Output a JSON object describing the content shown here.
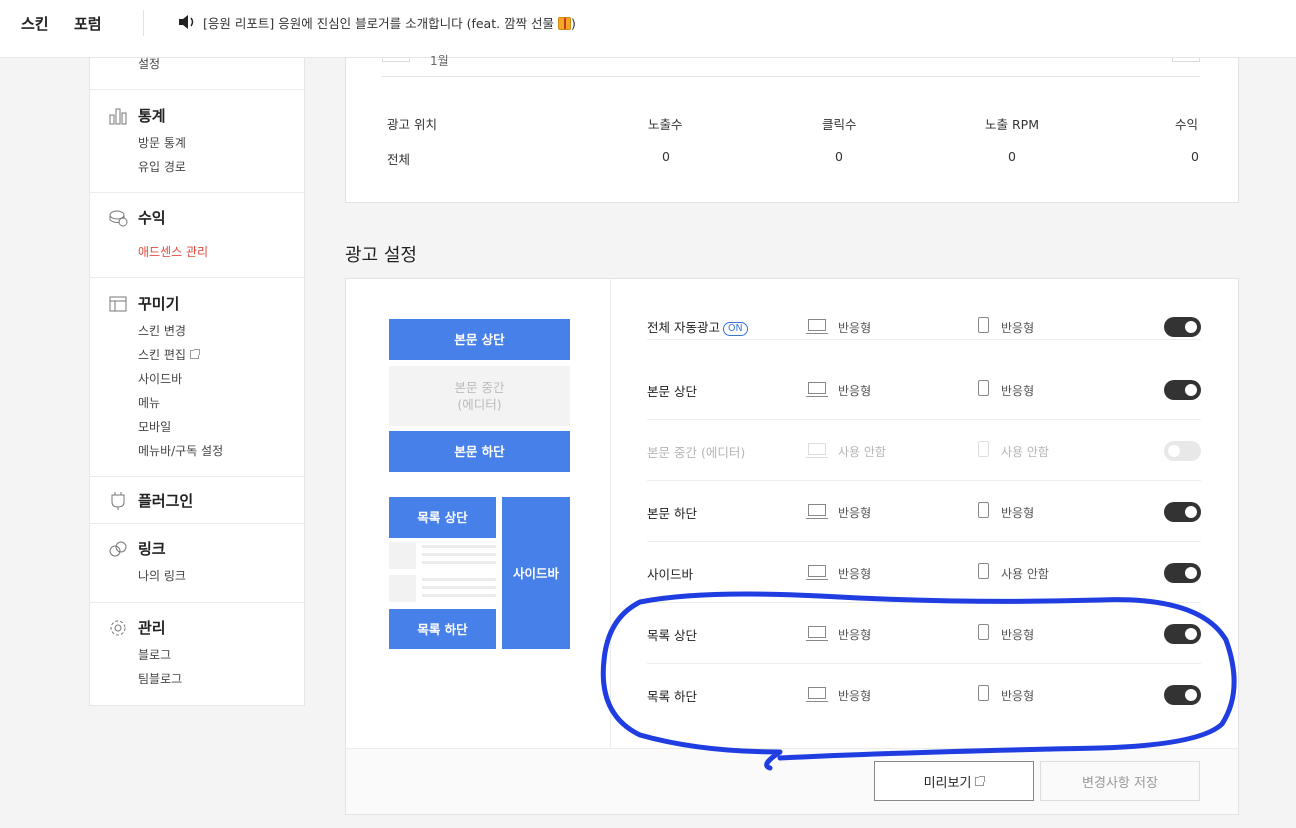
{
  "topbar": {
    "nav": [
      "스킨",
      "포럼"
    ],
    "notice": "[응원 리포트] 응원에 진심인 블로거를 소개합니다 (feat. 깜짝 선물",
    "notice_end": ")"
  },
  "sidebar": {
    "cut_link": "설정",
    "sections": [
      {
        "title": "통계",
        "icon": "bar-chart-icon",
        "links": [
          "방문 통계",
          "유입 경로"
        ]
      },
      {
        "title": "수익",
        "icon": "coins-icon",
        "links": [
          "애드센스 관리"
        ],
        "active": "애드센스 관리"
      },
      {
        "title": "꾸미기",
        "icon": "layout-icon",
        "links": [
          "스킨 변경",
          "스킨 편집",
          "사이드바",
          "메뉴",
          "모바일",
          "메뉴바/구독 설정"
        ]
      },
      {
        "title": "플러그인",
        "icon": "plug-icon",
        "links": []
      },
      {
        "title": "링크",
        "icon": "link-icon",
        "links": [
          "나의 링크"
        ]
      },
      {
        "title": "관리",
        "icon": "gear-icon",
        "links": [
          "블로그",
          "팀블로그"
        ]
      }
    ]
  },
  "stats": {
    "cut_label": "1월",
    "headers": [
      "광고 위치",
      "노출수",
      "클릭수",
      "노출 RPM",
      "수익"
    ],
    "row": [
      "전체",
      "0",
      "0",
      "0",
      "0"
    ]
  },
  "ad_settings": {
    "title": "광고 설정",
    "preview": {
      "top": "본문 상단",
      "middle_line1": "본문 중간",
      "middle_line2": "(에디터)",
      "bottom": "본문 하단",
      "list_top": "목록 상단",
      "list_bottom": "목록 하단",
      "sidebar": "사이드바"
    },
    "rows": [
      {
        "label": "전체 자동광고",
        "badge": "ON",
        "pc": "반응형",
        "mobile": "반응형",
        "enabled": true
      },
      {
        "label": "본문 상단",
        "pc": "반응형",
        "mobile": "반응형",
        "enabled": true
      },
      {
        "label": "본문 중간 (에디터)",
        "pc": "사용 안함",
        "mobile": "사용 안함",
        "enabled": false
      },
      {
        "label": "본문 하단",
        "pc": "반응형",
        "mobile": "반응형",
        "enabled": true
      },
      {
        "label": "사이드바",
        "pc": "반응형",
        "mobile": "사용 안함",
        "enabled": true
      },
      {
        "label": "목록 상단",
        "pc": "반응형",
        "mobile": "반응형",
        "enabled": true
      },
      {
        "label": "목록 하단",
        "pc": "반응형",
        "mobile": "반응형",
        "enabled": true
      }
    ],
    "buttons": {
      "preview": "미리보기",
      "save": "변경사항 저장"
    }
  },
  "colors": {
    "accent": "#4680e8",
    "active_link": "#e64a3b",
    "annotation": "#1f3de0",
    "toggle_on": "#333333"
  }
}
